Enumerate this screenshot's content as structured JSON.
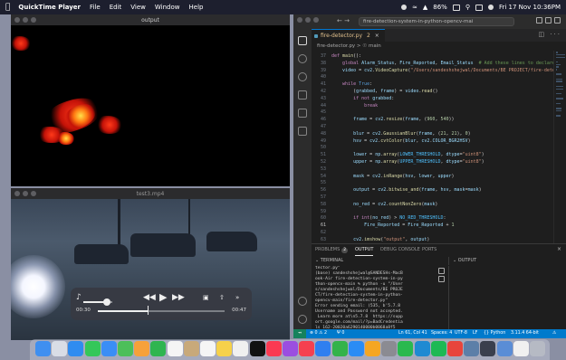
{
  "menubar": {
    "app": "QuickTime Player",
    "menus": [
      "File",
      "Edit",
      "View",
      "Window",
      "Help"
    ],
    "battery": "86%",
    "clock": "Fri 17 Nov 10:36PM"
  },
  "qt_output": {
    "title": "output"
  },
  "qt_video": {
    "title": "test3.mp4",
    "time_elapsed": "00:30",
    "time_remaining": "00:47",
    "progress": 0.39,
    "volume": 0.8
  },
  "vscode": {
    "search": "fire-detection-system-in-python-opencv-mai",
    "tab": {
      "name": "fire-detector.py",
      "modified": "2"
    },
    "breadcrumb": "fire-detector.py > ☉ main",
    "code": [
      {
        "n": "37",
        "t": "def main():"
      },
      {
        "n": "38",
        "t": "    global Alarm_Status, Fire_Reported, Email_Status  # Add these lines to declare"
      },
      {
        "n": "39",
        "t": "    video = cv2.VideoCapture(\"/Users/sandeshshejwal/Documents/BE PROJECT/fire-detect"
      },
      {
        "n": "40",
        "t": ""
      },
      {
        "n": "41",
        "t": "    while True:"
      },
      {
        "n": "42",
        "t": "        (grabbed, frame) = video.read()"
      },
      {
        "n": "43",
        "t": "        if not grabbed:"
      },
      {
        "n": "44",
        "t": "            break"
      },
      {
        "n": "45",
        "t": ""
      },
      {
        "n": "46",
        "t": "        frame = cv2.resize(frame, (960, 540))"
      },
      {
        "n": "47",
        "t": ""
      },
      {
        "n": "48",
        "t": "        blur = cv2.GaussianBlur(frame, (21, 21), 0)"
      },
      {
        "n": "49",
        "t": "        hsv = cv2.cvtColor(blur, cv2.COLOR_BGR2HSV)"
      },
      {
        "n": "50",
        "t": ""
      },
      {
        "n": "51",
        "t": "        lower = np.array(LOWER_THRESHOLD, dtype=\"uint8\")"
      },
      {
        "n": "52",
        "t": "        upper = np.array(UPPER_THRESHOLD, dtype=\"uint8\")"
      },
      {
        "n": "53",
        "t": ""
      },
      {
        "n": "54",
        "t": "        mask = cv2.inRange(hsv, lower, upper)"
      },
      {
        "n": "55",
        "t": ""
      },
      {
        "n": "56",
        "t": "        output = cv2.bitwise_and(frame, hsv, mask=mask)"
      },
      {
        "n": "57",
        "t": ""
      },
      {
        "n": "58",
        "t": "        no_red = cv2.countNonZero(mask)"
      },
      {
        "n": "59",
        "t": ""
      },
      {
        "n": "60",
        "t": "        if int(no_red) > NO_RED_THRESHOLD:"
      },
      {
        "n": "61",
        "t": "            Fire_Reported = Fire_Reported + 1"
      },
      {
        "n": "62",
        "t": ""
      },
      {
        "n": "63",
        "t": "        cv2.imshow(\"output\", output)"
      }
    ],
    "panel_tabs": [
      "PROBLEMS",
      "OUTPUT",
      "DEBUG CONSOLE",
      "PORTS"
    ],
    "problems_count": "2",
    "terminal_label": "TERMINAL",
    "output_label": "OUTPUT",
    "terminal_lines": [
      "tector.py\"",
      "(base) sandeshshejwal@SANDESHs-MacB",
      "ook-Air fire-detection-system-in-py",
      "thon-opencv-main % python -u \"/User",
      "s/sandeshshejwal/Documents/BE PROJE",
      "CT/fire-detection-system-in-python-",
      "opencv-main/fire-detector.py\"",
      "Error sending email: (535, b'5.7.8",
      "Username and Password not accepted.",
      " Learn more at\\n5.7.8  https://supp",
      "ort.google.com/mail/?p=BadCredentia",
      "ls 162-20020a6290140000b0068a8f5",
      "060ba0845119gpm.59 - gsmtp')"
    ],
    "status": {
      "errors": "0",
      "warnings": "2",
      "ports": "0",
      "position": "Ln 61, Col 41",
      "spaces": "Spaces: 4",
      "encoding": "UTF-8",
      "eol": "LF",
      "language": "Python",
      "interpreter": "3.11.4 64-bit"
    }
  },
  "colors": {
    "vs_accent": "#007acc",
    "menubar_bg": "#1d1f2e",
    "keyword": "#c586c0",
    "function": "#dcdcaa",
    "string": "#ce9178",
    "number": "#b5cea8",
    "constant": "#4fc1ff",
    "variable": "#9cdcfe",
    "comment": "#6a9955"
  },
  "dock_apps": [
    {
      "name": "finder-icon",
      "color": "#3f8ff0"
    },
    {
      "name": "launchpad-icon",
      "color": "#d9dde6"
    },
    {
      "name": "safari-icon",
      "color": "#2f8cf0"
    },
    {
      "name": "messages-icon",
      "color": "#34c759"
    },
    {
      "name": "mail-icon",
      "color": "#3a8ef6"
    },
    {
      "name": "maps-icon",
      "color": "#4cbf5a"
    },
    {
      "name": "photos-icon",
      "color": "#f6a13a"
    },
    {
      "name": "facetime-icon",
      "color": "#2fb550"
    },
    {
      "name": "calendar-icon",
      "color": "#f5f5f5"
    },
    {
      "name": "contacts-icon",
      "color": "#c8a97a"
    },
    {
      "name": "reminders-icon",
      "color": "#f5f5f5"
    },
    {
      "name": "notes-icon",
      "color": "#f6d14a"
    },
    {
      "name": "freeform-icon",
      "color": "#f0f0f0"
    },
    {
      "name": "tv-icon",
      "color": "#111111"
    },
    {
      "name": "music-icon",
      "color": "#fa3a52"
    },
    {
      "name": "podcasts-icon",
      "color": "#9b4ee0"
    },
    {
      "name": "news-icon",
      "color": "#f5404f"
    },
    {
      "name": "keynote-icon",
      "color": "#2f7ff0"
    },
    {
      "name": "numbers-icon",
      "color": "#33b34a"
    },
    {
      "name": "app-store-icon",
      "color": "#2a8cf5"
    },
    {
      "name": "xcode-icon",
      "color": "#f5a623"
    },
    {
      "name": "system-settings-icon",
      "color": "#8b8b92"
    },
    {
      "name": "whatsapp-icon",
      "color": "#29b94e"
    },
    {
      "name": "vscode-icon",
      "color": "#1f8ad2"
    },
    {
      "name": "spotify-icon",
      "color": "#1db954"
    },
    {
      "name": "chrome-icon",
      "color": "#e8453c"
    },
    {
      "name": "preview-icon",
      "color": "#5c7fa8"
    },
    {
      "name": "quicktime-icon",
      "color": "#3a3f4d"
    },
    {
      "name": "finder-window-icon",
      "color": "#5a8dd6"
    },
    {
      "name": "document-icon",
      "color": "#f0f0f0"
    },
    {
      "name": "trash-icon",
      "color": "#b6bac4"
    }
  ]
}
